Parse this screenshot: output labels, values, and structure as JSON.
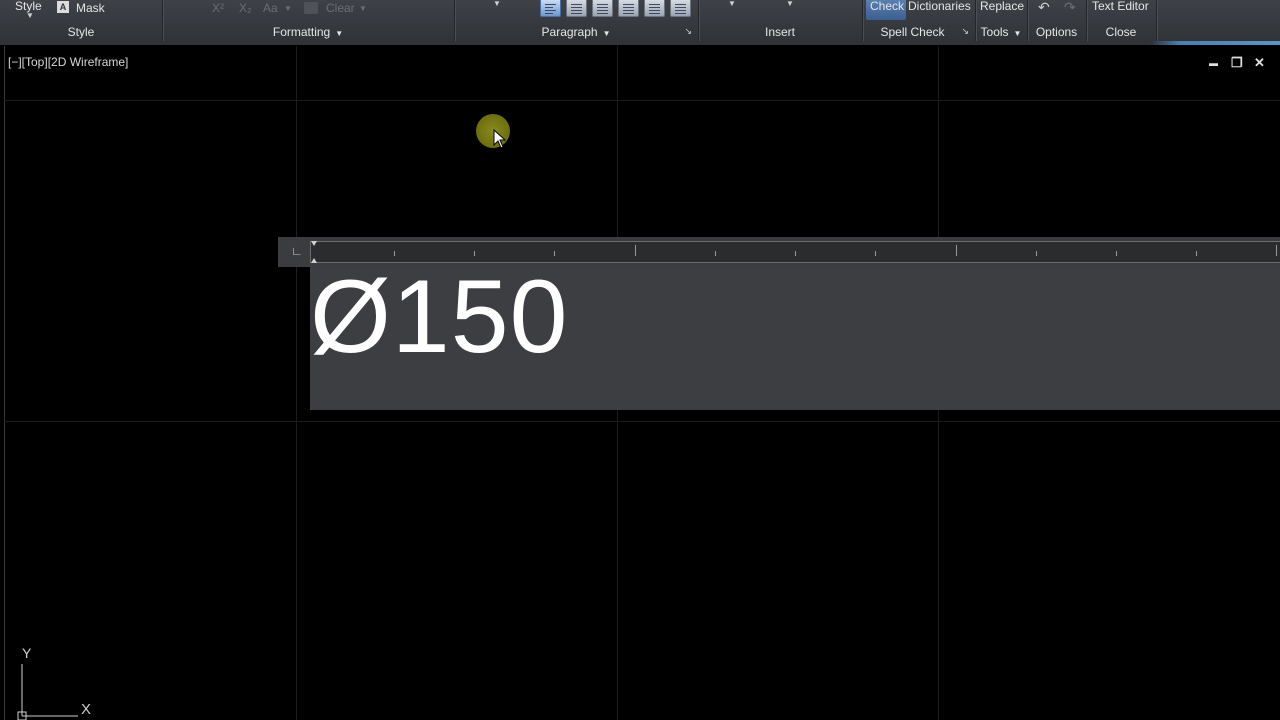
{
  "ribbon": {
    "style_panel": {
      "title": "Style",
      "style_label": "Style",
      "mask_label": "Mask"
    },
    "formatting_panel": {
      "title": "Formatting",
      "superscript": "X²",
      "subscript": "X₂",
      "case": "Aa",
      "clear": "Clear"
    },
    "paragraph_panel": {
      "title": "Paragraph"
    },
    "insert_panel": {
      "title": "Insert"
    },
    "spell_check_panel": {
      "title": "Spell Check",
      "check": "Check",
      "dictionaries": "Dictionaries"
    },
    "tools_panel": {
      "title": "Tools",
      "replace": "Replace"
    },
    "options_panel": {
      "title": "Options"
    },
    "close_panel": {
      "title": "Close",
      "text_editor": "Text Editor"
    }
  },
  "viewport": {
    "label": "[−][Top][2D Wireframe]",
    "minimize": "▬",
    "restore": "❐",
    "close": "✕"
  },
  "editor": {
    "corner_symbol": "∟",
    "text": "Ø150"
  },
  "ucs": {
    "y_label": "Y",
    "x_label": "X"
  },
  "colors": {
    "ribbon_bg": "#34373c",
    "viewport_bg": "#000000",
    "editor_bg": "#3c3e42",
    "cursor_highlight": "#7a7a18",
    "check_active": "#4a6fa0"
  },
  "icons": [
    "mask-icon",
    "paragraph-align-icons",
    "undo-icon",
    "redo-icon",
    "cursor-arrow-icon",
    "ucs-icon"
  ]
}
